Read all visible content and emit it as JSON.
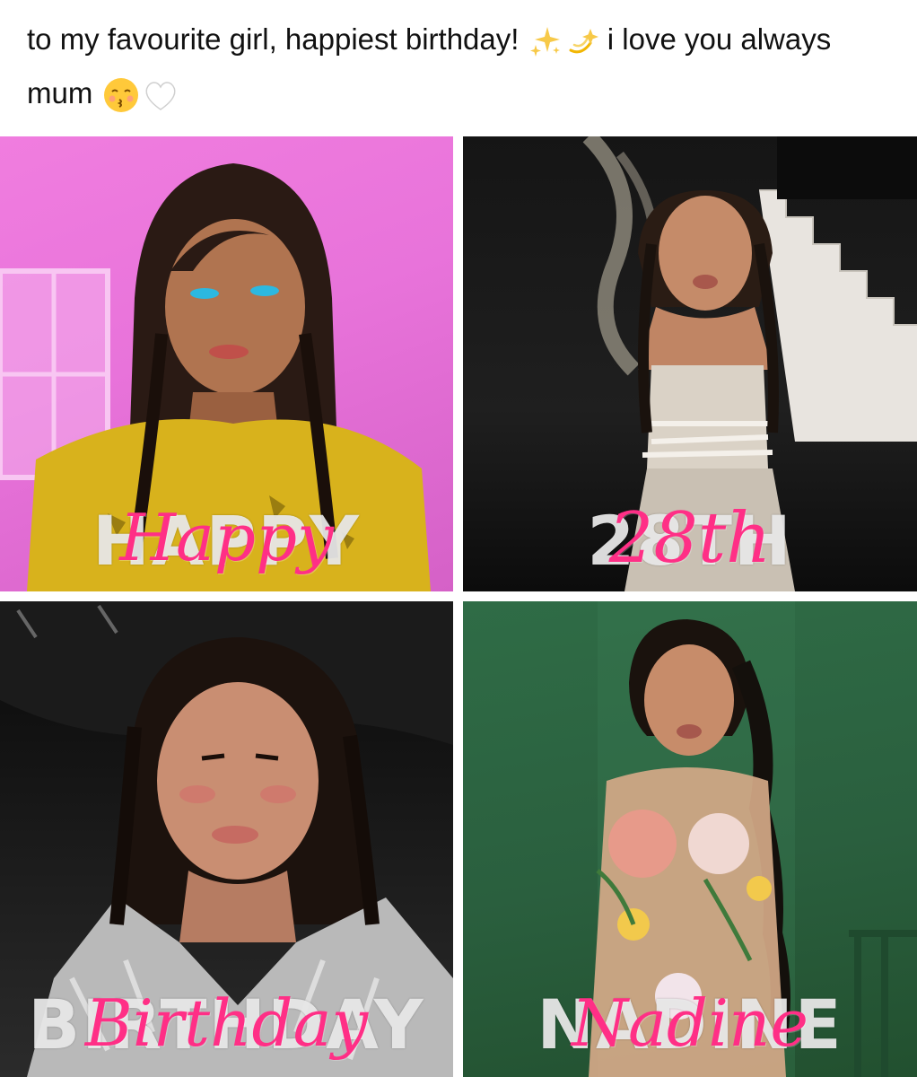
{
  "post": {
    "caption_part1": "to my favourite girl, happiest birthday! ",
    "caption_part2": " i love you always mum ",
    "emojis": [
      "sparkles-icon",
      "dizzy-icon",
      "kissing-face-icon",
      "white-heart-icon"
    ]
  },
  "tiles": [
    {
      "block": "HAPPY",
      "script": "Happy",
      "bg": "#e873da"
    },
    {
      "block": "28TH",
      "script": "28th",
      "bg": "#1a1a1a"
    },
    {
      "block": "BIRTHDAY",
      "script": "Birthday",
      "bg": "#111111"
    },
    {
      "block": "NADINE",
      "script": "Nadine",
      "bg": "#2c6440"
    }
  ],
  "colors": {
    "script_pink": "#ff2f86",
    "block_white": "#ebebeb"
  }
}
